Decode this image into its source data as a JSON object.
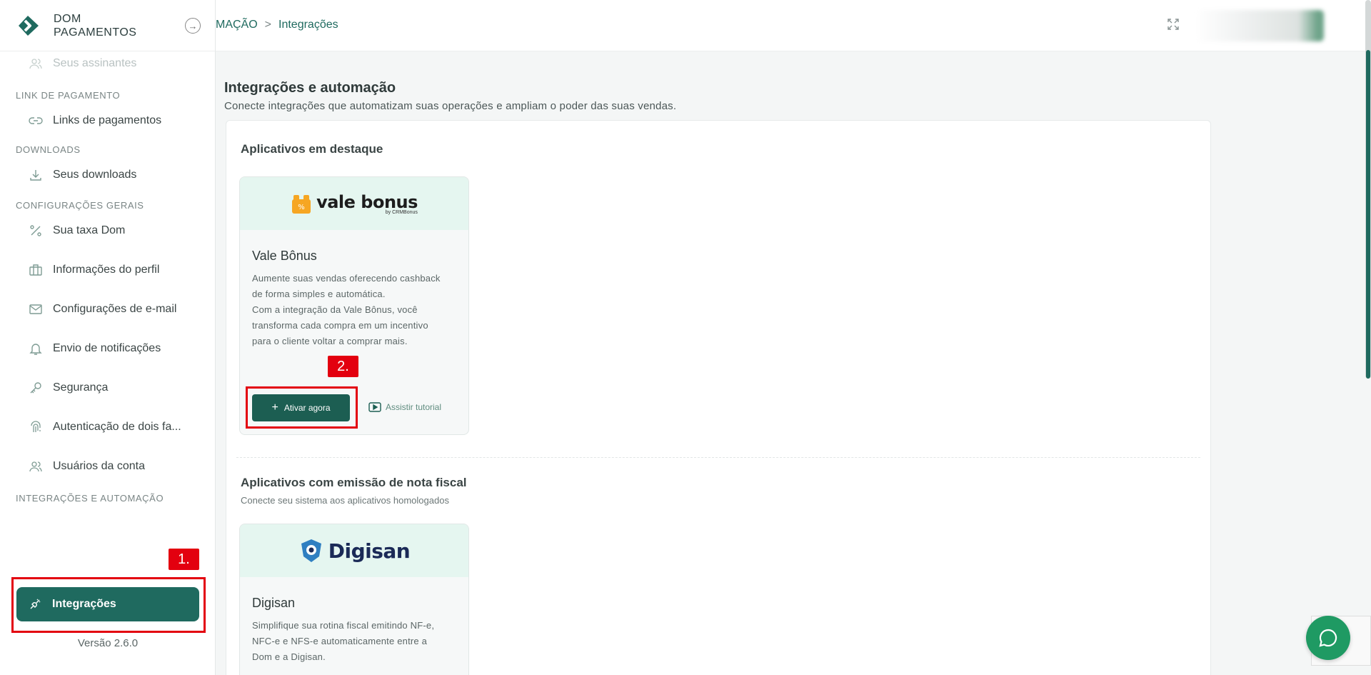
{
  "brand": {
    "line1": "DOM",
    "line2": "PAGAMENTOS"
  },
  "sidebar": {
    "faded_item": "Seus assinantes",
    "sections": [
      {
        "title": "LINK DE PAGAMENTO",
        "items": [
          "Links de pagamentos"
        ]
      },
      {
        "title": "DOWNLOADS",
        "items": [
          "Seus downloads"
        ]
      },
      {
        "title": "CONFIGURAÇÕES GERAIS",
        "items": [
          "Sua taxa Dom",
          "Informações do perfil",
          "Configurações de e-mail",
          "Envio de notificações",
          "Segurança",
          "Autenticação de dois fa...",
          "Usuários da conta"
        ]
      },
      {
        "title": "INTEGRAÇÕES E AUTOMAÇÃO",
        "items": []
      }
    ],
    "active_item": "Integrações",
    "version": "Versão 2.6.0"
  },
  "breadcrumb": {
    "parent": "MAÇÃO",
    "separator": ">",
    "current": "Integrações"
  },
  "page": {
    "title": "Integrações e automação",
    "subtitle": "Conecte integrações que automatizam suas operações e ampliam o poder das suas vendas."
  },
  "featured": {
    "title": "Aplicativos em destaque",
    "card": {
      "logo_text": "vale bonus",
      "logo_sub": "by CRMBonus",
      "name": "Vale Bônus",
      "desc": [
        "Aumente suas vendas oferecendo cashback",
        "de forma simples e automática.",
        "Com a integração da Vale Bônus, você",
        "transforma cada compra em um incentivo",
        "para o cliente voltar a comprar mais."
      ],
      "primary": "Ativar agora",
      "secondary": "Assistir tutorial"
    }
  },
  "fiscal": {
    "title": "Aplicativos com emissão de nota fiscal",
    "subtitle": "Conecte seu sistema aos aplicativos homologados",
    "card": {
      "logo_text": "Digisan",
      "name": "Digisan",
      "desc": [
        "Simplifique sua rotina fiscal emitindo NF-e,",
        "NFC-e e NFS-e automaticamente entre a",
        "Dom e a Digisan."
      ]
    }
  },
  "annotations": {
    "one": "1.",
    "two": "2."
  },
  "colors": {
    "primary": "#1f6a5f",
    "button": "#1c5e52",
    "annotation": "#e3000f",
    "card_head": "#e5f6f0",
    "chat": "#1f9a63"
  }
}
